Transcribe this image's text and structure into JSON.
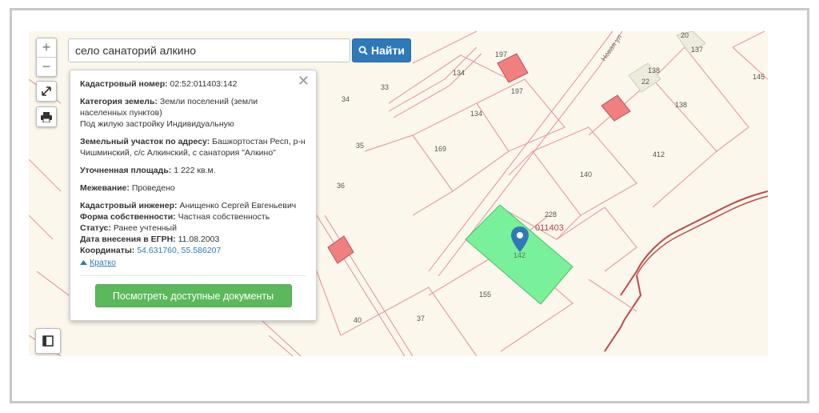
{
  "search": {
    "value": "село санаторий алкино"
  },
  "find_button": {
    "label": "Найти"
  },
  "zoom": {
    "in": "+",
    "out": "−"
  },
  "popup": {
    "close": "✕",
    "cad_number": {
      "label": "Кадастровый номер:",
      "value": "02:52:011403:142"
    },
    "category": {
      "label": "Категория земель:",
      "value": "Земли поселений (земли населенных пунктов)",
      "extra": "Под жилую застройку Индивидуальную"
    },
    "address": {
      "label": "Земельный участок по адресу:",
      "value": "Башкортостан Респ, р-н Чишминский, с/с Алкинский, с санатория \"Алкино\""
    },
    "area": {
      "label": "Уточненная площадь:",
      "value": "1 222 кв.м."
    },
    "survey": {
      "label": "Межевание:",
      "value": "Проведено"
    },
    "engineer": {
      "label": "Кадастровый инженер:",
      "value": "Анищенко Сергей Евгеньевич"
    },
    "ownership": {
      "label": "Форма собственности:",
      "value": "Частная собственность"
    },
    "status": {
      "label": "Статус:",
      "value": "Ранее учтенный"
    },
    "egrn_date": {
      "label": "Дата внесения в ЕГРН:",
      "value": "11.08.2003"
    },
    "coords": {
      "label": "Координаты:",
      "value": "54.631760, 55.586207"
    },
    "brief": "Кратко",
    "docs_button": "Посмотреть доступные документы"
  },
  "map": {
    "selected_parcel": "142",
    "quarter": "011403",
    "street": "Новая ул",
    "parcels": [
      "20",
      "137",
      "197",
      "134",
      "197",
      "33",
      "34",
      "35",
      "169",
      "134",
      "138",
      "22",
      "138",
      "145",
      "412",
      "140",
      "228",
      "36",
      "155",
      "40",
      "37"
    ],
    "colors": {
      "selected": "#79f09a",
      "boundary": "#e7a0a0",
      "building": "#f08080",
      "marker": "#2f79b9"
    }
  }
}
